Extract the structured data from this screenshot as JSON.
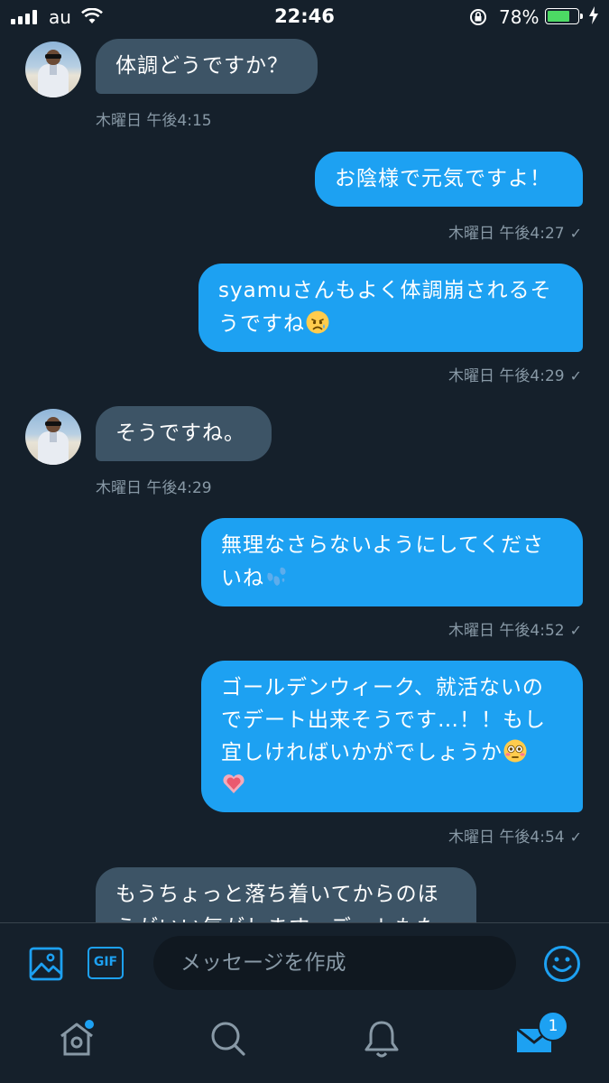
{
  "status_bar": {
    "carrier": "au",
    "time": "22:46",
    "battery_percent": "78%",
    "battery_level": 0.78,
    "battery_color": "#4cd964"
  },
  "messages": [
    {
      "direction": "in",
      "lines": [
        "体調どうですか？"
      ],
      "timestamp": "木曜日 午後4:15"
    },
    {
      "direction": "out",
      "lines": [
        "お陰様で元気ですよ！"
      ],
      "timestamp": "木曜日 午後4:27",
      "check": "✓"
    },
    {
      "direction": "out",
      "lines": [
        "syamuさんもよく体調崩されるそ",
        "うですね"
      ],
      "emoji": "sad-face",
      "timestamp": "木曜日 午後4:29",
      "check": "✓"
    },
    {
      "direction": "in",
      "lines": [
        "そうですね。"
      ],
      "timestamp": "木曜日 午後4:29"
    },
    {
      "direction": "out",
      "lines": [
        "無理なさらないようにしてくださ",
        "いね"
      ],
      "emoji": "sweat-droplets",
      "timestamp": "木曜日 午後4:52",
      "check": "✓"
    },
    {
      "direction": "out",
      "lines": [
        "ゴールデンウィーク、就活ないの",
        "でデート出来そうです…！！もし",
        "宜しければいかがでしょうか"
      ],
      "emoji": "flushed-face",
      "emoji2": "growing-heart",
      "timestamp": "木曜日 午後4:54",
      "check": "✓"
    },
    {
      "direction": "in",
      "lines": [
        "もうちょっと落ち着いてからのほ",
        "うがいい気がします。デートもた"
      ]
    }
  ],
  "composer": {
    "placeholder": "メッセージを作成",
    "gif_label": "GIF"
  },
  "tab_bar": {
    "items": [
      "home-icon",
      "search-icon",
      "notifications-icon",
      "messages-icon"
    ],
    "messages_badge": "1"
  },
  "colors": {
    "background": "#15202b",
    "accent": "#1da1f2",
    "incoming_bubble": "#3d5466",
    "secondary_text": "#8899a6"
  }
}
